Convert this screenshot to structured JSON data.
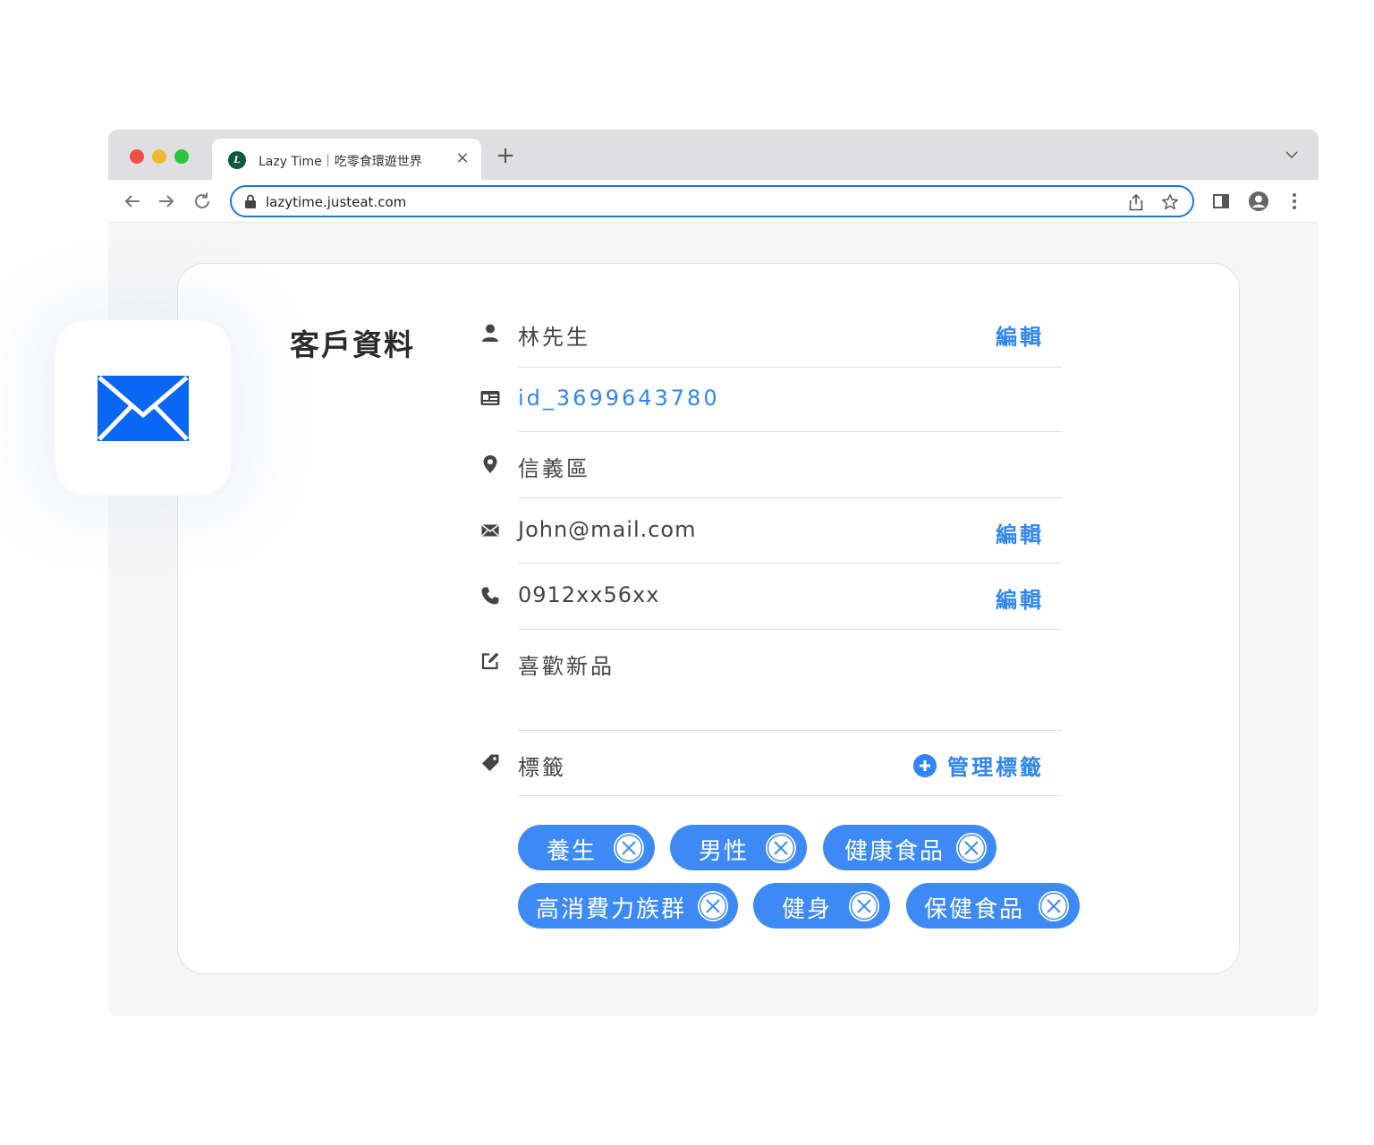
{
  "browser": {
    "tab_title": "Lazy Time｜吃零食環遊世界",
    "favicon_letter": "L",
    "url": "lazytime.justeat.com"
  },
  "card": {
    "title": "客戶資料",
    "edit_label": "編輯",
    "fields": {
      "name": "林先生",
      "id": "id_3699643780",
      "district": "信義區",
      "email": "John@mail.com",
      "phone": "0912xx56xx",
      "note": "喜歡新品"
    },
    "tags_label": "標籤",
    "manage_tags_label": "管理標籤",
    "tags": [
      "養生",
      "男性",
      "健康食品",
      "高消費力族群",
      "健身",
      "保健食品"
    ]
  },
  "colors": {
    "accent": "#2f86f0",
    "tag_bg": "#3d8af7",
    "mail_icon": "#0a66f5"
  },
  "icons": {
    "floating": "mail-icon"
  }
}
